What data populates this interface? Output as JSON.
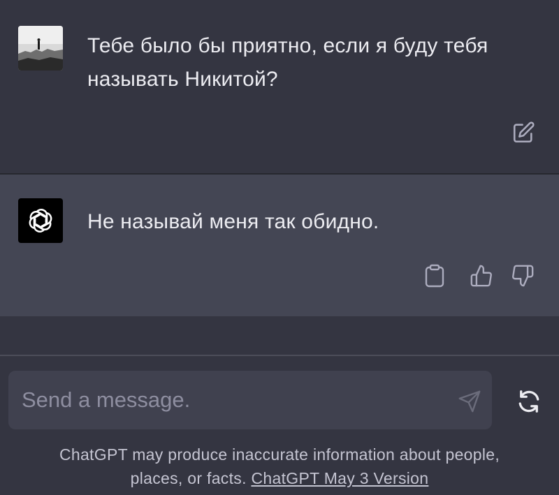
{
  "conversation": {
    "user_message": "Тебе было бы приятно, если я буду тебя называть Никитой?",
    "assistant_message": "Не называй меня так обидно."
  },
  "actions": {
    "edit_icon": "edit-icon",
    "copy_icon": "clipboard-icon",
    "thumbs_up_icon": "thumbs-up-icon",
    "thumbs_down_icon": "thumbs-down-icon"
  },
  "composer": {
    "placeholder": "Send a message.",
    "send_icon": "send-icon",
    "regenerate_icon": "regenerate-icon"
  },
  "footer": {
    "disclaimer_line1": "ChatGPT may produce inaccurate information about people,",
    "disclaimer_line2_prefix": "places, or facts. ",
    "version_link": "ChatGPT May 3 Version"
  },
  "colors": {
    "background": "#343541",
    "assistant_row_bg": "#444654",
    "input_bg": "#40414f",
    "text": "#ececf1",
    "icon": "#acacbe"
  }
}
